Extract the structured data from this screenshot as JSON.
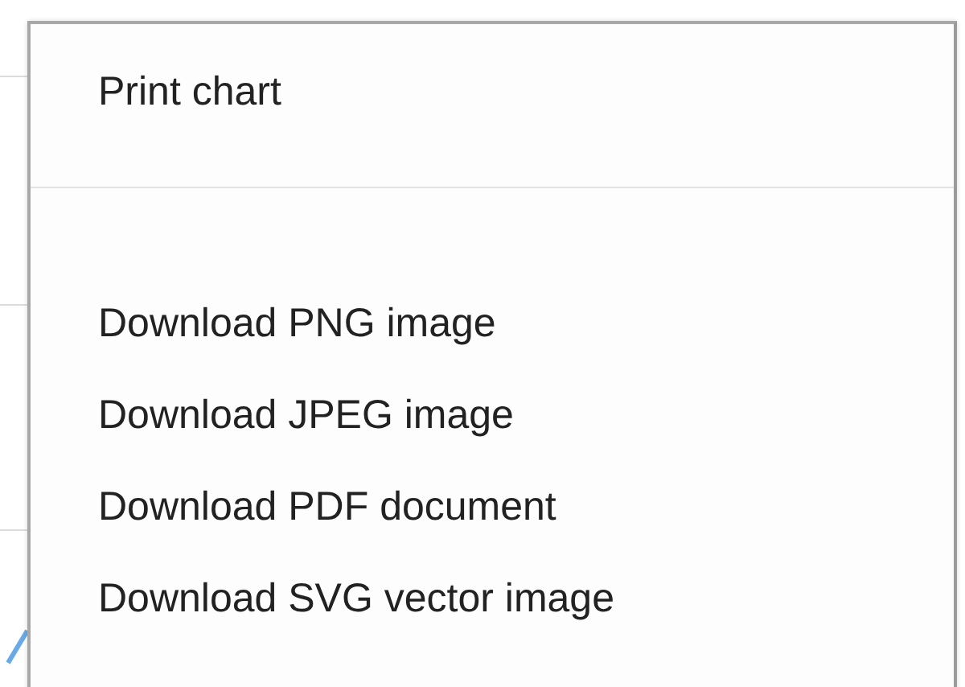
{
  "menu": {
    "items": [
      {
        "kind": "item",
        "label": "Print chart"
      },
      {
        "kind": "separator"
      },
      {
        "kind": "item",
        "label": "Download PNG image"
      },
      {
        "kind": "item",
        "label": "Download JPEG image"
      },
      {
        "kind": "item",
        "label": "Download PDF document"
      },
      {
        "kind": "item",
        "label": "Download SVG vector image"
      }
    ]
  }
}
